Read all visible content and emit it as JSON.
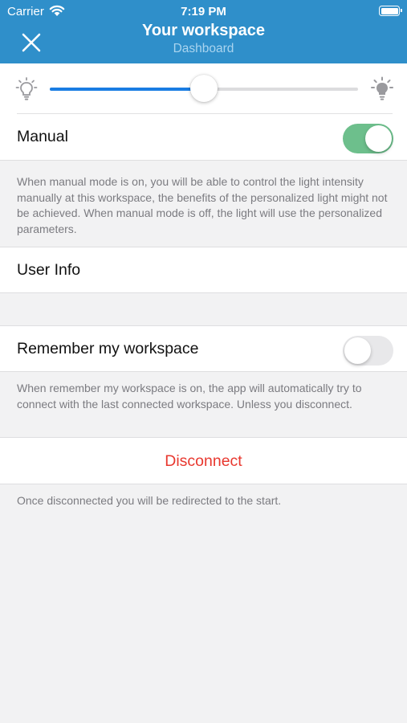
{
  "status_bar": {
    "carrier": "Carrier",
    "time": "7:19 PM"
  },
  "header": {
    "title": "Your workspace",
    "subtitle": "Dashboard",
    "close_icon": "close-icon",
    "background": "#2f8fca"
  },
  "brightness": {
    "value_percent": 50,
    "min_icon": "lightbulb-dim-icon",
    "max_icon": "lightbulb-bright-icon",
    "accent": "#1a7de3"
  },
  "manual": {
    "label": "Manual",
    "enabled": true,
    "description": "When manual mode is on, you will be able to control the light intensity manually at this workspace, the benefits of the personalized light might not be achieved. When manual mode is off, the light will use the personalized parameters."
  },
  "user_info": {
    "label": "User Info"
  },
  "remember": {
    "label": "Remember my workspace",
    "enabled": false,
    "description": "When remember my workspace is on, the app will automatically try to connect with the last connected workspace. Unless you disconnect."
  },
  "disconnect": {
    "label": "Disconnect",
    "note": "Once disconnected you will be redirected to the start.",
    "color": "#e8382f"
  },
  "toggle_on_color": "#6dbf8c"
}
